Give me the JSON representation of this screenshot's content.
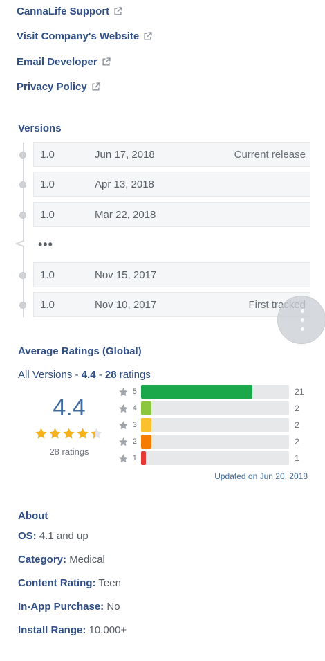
{
  "links": [
    {
      "label": "CannaLife Support",
      "icon": "external-link-icon"
    },
    {
      "label": "Visit Company's Website",
      "icon": "external-link-icon"
    },
    {
      "label": "Email Developer",
      "icon": "external-link-icon"
    },
    {
      "label": "Privacy Policy",
      "icon": "external-link-icon"
    }
  ],
  "versions": {
    "title": "Versions",
    "rows": [
      {
        "version": "1.0",
        "date": "Jun 17, 2018",
        "note": "Current release"
      },
      {
        "version": "1.0",
        "date": "Apr 13, 2018",
        "note": ""
      },
      {
        "version": "1.0",
        "date": "Mar 22, 2018",
        "note": ""
      },
      {
        "version": "1.0",
        "date": "Nov 15, 2017",
        "note": ""
      },
      {
        "version": "1.0",
        "date": "Nov 10, 2017",
        "note": "First tracked"
      }
    ],
    "ellipsis": "•••"
  },
  "ratings": {
    "title": "Average Ratings (Global)",
    "sub_prefix": "All Versions - ",
    "sub_score": "4.4",
    "sub_sep": " - ",
    "sub_count": "28",
    "sub_suffix": " ratings",
    "score": "4.4",
    "stars_value": 4.4,
    "ratings_label": "28 ratings",
    "bars": [
      {
        "star": "5",
        "count": "21",
        "fraction": 0.75,
        "color": "#1ba84a"
      },
      {
        "star": "4",
        "count": "2",
        "fraction": 0.07,
        "color": "#8cc63f"
      },
      {
        "star": "3",
        "count": "2",
        "fraction": 0.07,
        "color": "#fbc02d"
      },
      {
        "star": "2",
        "count": "2",
        "fraction": 0.07,
        "color": "#f57c00"
      },
      {
        "star": "1",
        "count": "1",
        "fraction": 0.035,
        "color": "#e53935"
      }
    ],
    "updated": "Updated on Jun 20, 2018"
  },
  "about": {
    "title": "About",
    "items": [
      {
        "label": "OS:",
        "value": "4.1 and up"
      },
      {
        "label": "Category:",
        "value": "Medical"
      },
      {
        "label": "Content Rating:",
        "value": "Teen"
      },
      {
        "label": "In-App Purchase:",
        "value": "No"
      },
      {
        "label": "Install Range:",
        "value": "10,000+"
      }
    ]
  },
  "colors": {
    "link": "#2f4f86",
    "accent": "#3f6ba0",
    "star": "#f6b21b"
  }
}
